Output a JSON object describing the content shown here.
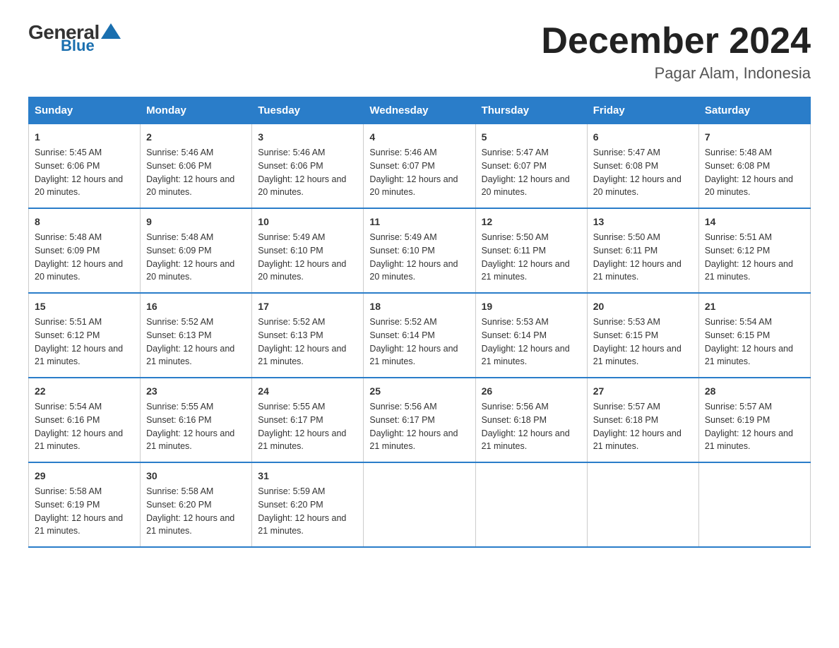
{
  "logo": {
    "text_general": "General",
    "text_blue": "Blue",
    "triangle": "▲"
  },
  "title": "December 2024",
  "location": "Pagar Alam, Indonesia",
  "days_of_week": [
    "Sunday",
    "Monday",
    "Tuesday",
    "Wednesday",
    "Thursday",
    "Friday",
    "Saturday"
  ],
  "weeks": [
    [
      {
        "day": "1",
        "sunrise": "5:45 AM",
        "sunset": "6:06 PM",
        "daylight": "12 hours and 20 minutes."
      },
      {
        "day": "2",
        "sunrise": "5:46 AM",
        "sunset": "6:06 PM",
        "daylight": "12 hours and 20 minutes."
      },
      {
        "day": "3",
        "sunrise": "5:46 AM",
        "sunset": "6:06 PM",
        "daylight": "12 hours and 20 minutes."
      },
      {
        "day": "4",
        "sunrise": "5:46 AM",
        "sunset": "6:07 PM",
        "daylight": "12 hours and 20 minutes."
      },
      {
        "day": "5",
        "sunrise": "5:47 AM",
        "sunset": "6:07 PM",
        "daylight": "12 hours and 20 minutes."
      },
      {
        "day": "6",
        "sunrise": "5:47 AM",
        "sunset": "6:08 PM",
        "daylight": "12 hours and 20 minutes."
      },
      {
        "day": "7",
        "sunrise": "5:48 AM",
        "sunset": "6:08 PM",
        "daylight": "12 hours and 20 minutes."
      }
    ],
    [
      {
        "day": "8",
        "sunrise": "5:48 AM",
        "sunset": "6:09 PM",
        "daylight": "12 hours and 20 minutes."
      },
      {
        "day": "9",
        "sunrise": "5:48 AM",
        "sunset": "6:09 PM",
        "daylight": "12 hours and 20 minutes."
      },
      {
        "day": "10",
        "sunrise": "5:49 AM",
        "sunset": "6:10 PM",
        "daylight": "12 hours and 20 minutes."
      },
      {
        "day": "11",
        "sunrise": "5:49 AM",
        "sunset": "6:10 PM",
        "daylight": "12 hours and 20 minutes."
      },
      {
        "day": "12",
        "sunrise": "5:50 AM",
        "sunset": "6:11 PM",
        "daylight": "12 hours and 21 minutes."
      },
      {
        "day": "13",
        "sunrise": "5:50 AM",
        "sunset": "6:11 PM",
        "daylight": "12 hours and 21 minutes."
      },
      {
        "day": "14",
        "sunrise": "5:51 AM",
        "sunset": "6:12 PM",
        "daylight": "12 hours and 21 minutes."
      }
    ],
    [
      {
        "day": "15",
        "sunrise": "5:51 AM",
        "sunset": "6:12 PM",
        "daylight": "12 hours and 21 minutes."
      },
      {
        "day": "16",
        "sunrise": "5:52 AM",
        "sunset": "6:13 PM",
        "daylight": "12 hours and 21 minutes."
      },
      {
        "day": "17",
        "sunrise": "5:52 AM",
        "sunset": "6:13 PM",
        "daylight": "12 hours and 21 minutes."
      },
      {
        "day": "18",
        "sunrise": "5:52 AM",
        "sunset": "6:14 PM",
        "daylight": "12 hours and 21 minutes."
      },
      {
        "day": "19",
        "sunrise": "5:53 AM",
        "sunset": "6:14 PM",
        "daylight": "12 hours and 21 minutes."
      },
      {
        "day": "20",
        "sunrise": "5:53 AM",
        "sunset": "6:15 PM",
        "daylight": "12 hours and 21 minutes."
      },
      {
        "day": "21",
        "sunrise": "5:54 AM",
        "sunset": "6:15 PM",
        "daylight": "12 hours and 21 minutes."
      }
    ],
    [
      {
        "day": "22",
        "sunrise": "5:54 AM",
        "sunset": "6:16 PM",
        "daylight": "12 hours and 21 minutes."
      },
      {
        "day": "23",
        "sunrise": "5:55 AM",
        "sunset": "6:16 PM",
        "daylight": "12 hours and 21 minutes."
      },
      {
        "day": "24",
        "sunrise": "5:55 AM",
        "sunset": "6:17 PM",
        "daylight": "12 hours and 21 minutes."
      },
      {
        "day": "25",
        "sunrise": "5:56 AM",
        "sunset": "6:17 PM",
        "daylight": "12 hours and 21 minutes."
      },
      {
        "day": "26",
        "sunrise": "5:56 AM",
        "sunset": "6:18 PM",
        "daylight": "12 hours and 21 minutes."
      },
      {
        "day": "27",
        "sunrise": "5:57 AM",
        "sunset": "6:18 PM",
        "daylight": "12 hours and 21 minutes."
      },
      {
        "day": "28",
        "sunrise": "5:57 AM",
        "sunset": "6:19 PM",
        "daylight": "12 hours and 21 minutes."
      }
    ],
    [
      {
        "day": "29",
        "sunrise": "5:58 AM",
        "sunset": "6:19 PM",
        "daylight": "12 hours and 21 minutes."
      },
      {
        "day": "30",
        "sunrise": "5:58 AM",
        "sunset": "6:20 PM",
        "daylight": "12 hours and 21 minutes."
      },
      {
        "day": "31",
        "sunrise": "5:59 AM",
        "sunset": "6:20 PM",
        "daylight": "12 hours and 21 minutes."
      },
      null,
      null,
      null,
      null
    ]
  ],
  "labels": {
    "sunrise": "Sunrise:",
    "sunset": "Sunset:",
    "daylight": "Daylight:"
  }
}
